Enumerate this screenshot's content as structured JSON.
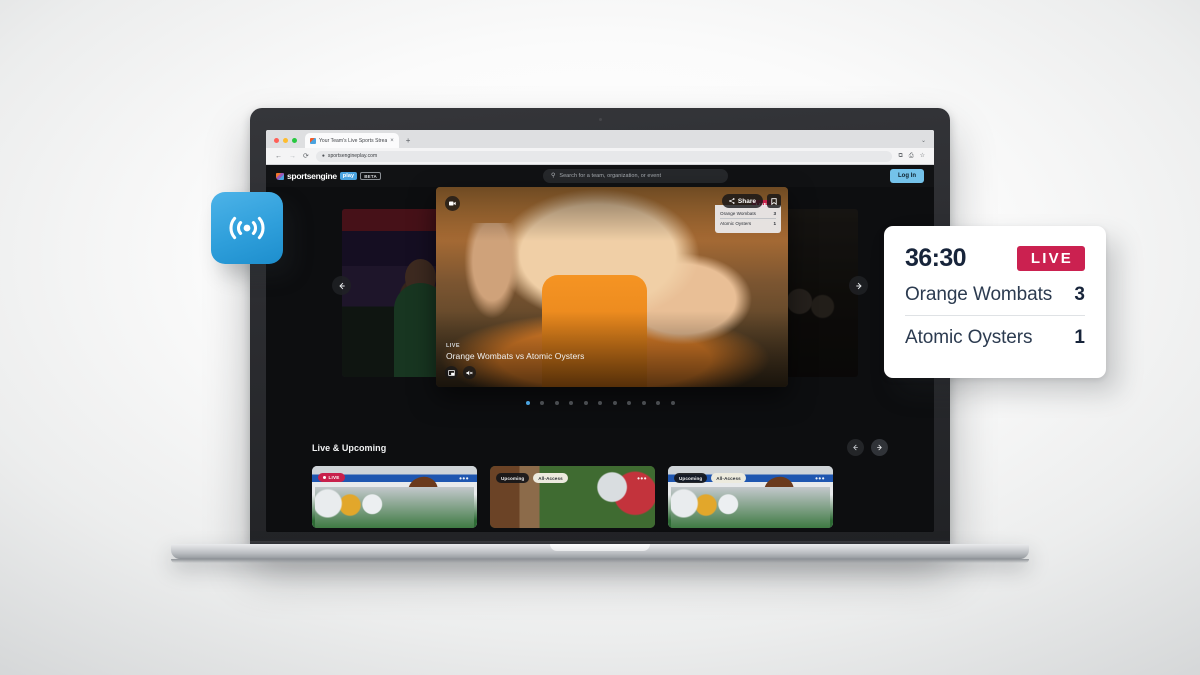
{
  "browser": {
    "tab_title": "Your Team's Live Sports Strea",
    "tab_close": "×",
    "new_tab": "+",
    "tabstrip_chevron": "⌄",
    "back": "←",
    "forward": "→",
    "reload": "⟳",
    "lock": "🔒",
    "url": "sportsengineplay.com",
    "omni_icon_1": "⧉",
    "omni_icon_2": "⎙",
    "omni_icon_3": "☆"
  },
  "site": {
    "brand": {
      "name": "sportsengine",
      "play_badge": "play",
      "beta_badge": "BETA"
    },
    "search": {
      "placeholder": "Search for a team, organization, or event",
      "icon": "search-icon"
    },
    "login_label": "Log In"
  },
  "hero": {
    "prev_arrow": "←",
    "next_arrow": "→",
    "dots_total": 11,
    "active_dot": 0,
    "video": {
      "camera_icon": "⧉",
      "share_label": "Share",
      "share_icon": "share-icon",
      "bookmark_icon": "bookmark-icon",
      "live_badge": "LIVE",
      "live_label": "LIVE",
      "title": "Orange Wombats vs Atomic Oysters",
      "pip_icon": "pip-icon",
      "mute_icon": "mute-icon",
      "mini_score": [
        {
          "team": "Orange Wombats",
          "score": "3"
        },
        {
          "team": "Atomic Oysters",
          "score": "1"
        }
      ]
    }
  },
  "live_upcoming": {
    "title": "Live & Upcoming",
    "prev_arrow": "←",
    "next_arrow": "→",
    "cards": [
      {
        "badges": [
          {
            "type": "live",
            "label": "LIVE"
          }
        ],
        "more": "•••",
        "photo": "football"
      },
      {
        "badges": [
          {
            "type": "upcoming",
            "label": "Upcoming"
          },
          {
            "type": "access",
            "label": "All-Access"
          }
        ],
        "more": "•••",
        "photo": "grass"
      },
      {
        "badges": [
          {
            "type": "upcoming",
            "label": "Upcoming"
          },
          {
            "type": "access",
            "label": "All-Access"
          }
        ],
        "more": "•••",
        "photo": "football"
      }
    ]
  },
  "overlays": {
    "signal_badge": {
      "icon": "broadcast-icon",
      "color": "#2f9fdb"
    },
    "scorecard": {
      "clock": "36:30",
      "live_label": "LIVE",
      "live_color": "#cb2150",
      "rows": [
        {
          "team": "Orange Wombats",
          "score": "3"
        },
        {
          "team": "Atomic Oysters",
          "score": "1"
        }
      ]
    }
  }
}
